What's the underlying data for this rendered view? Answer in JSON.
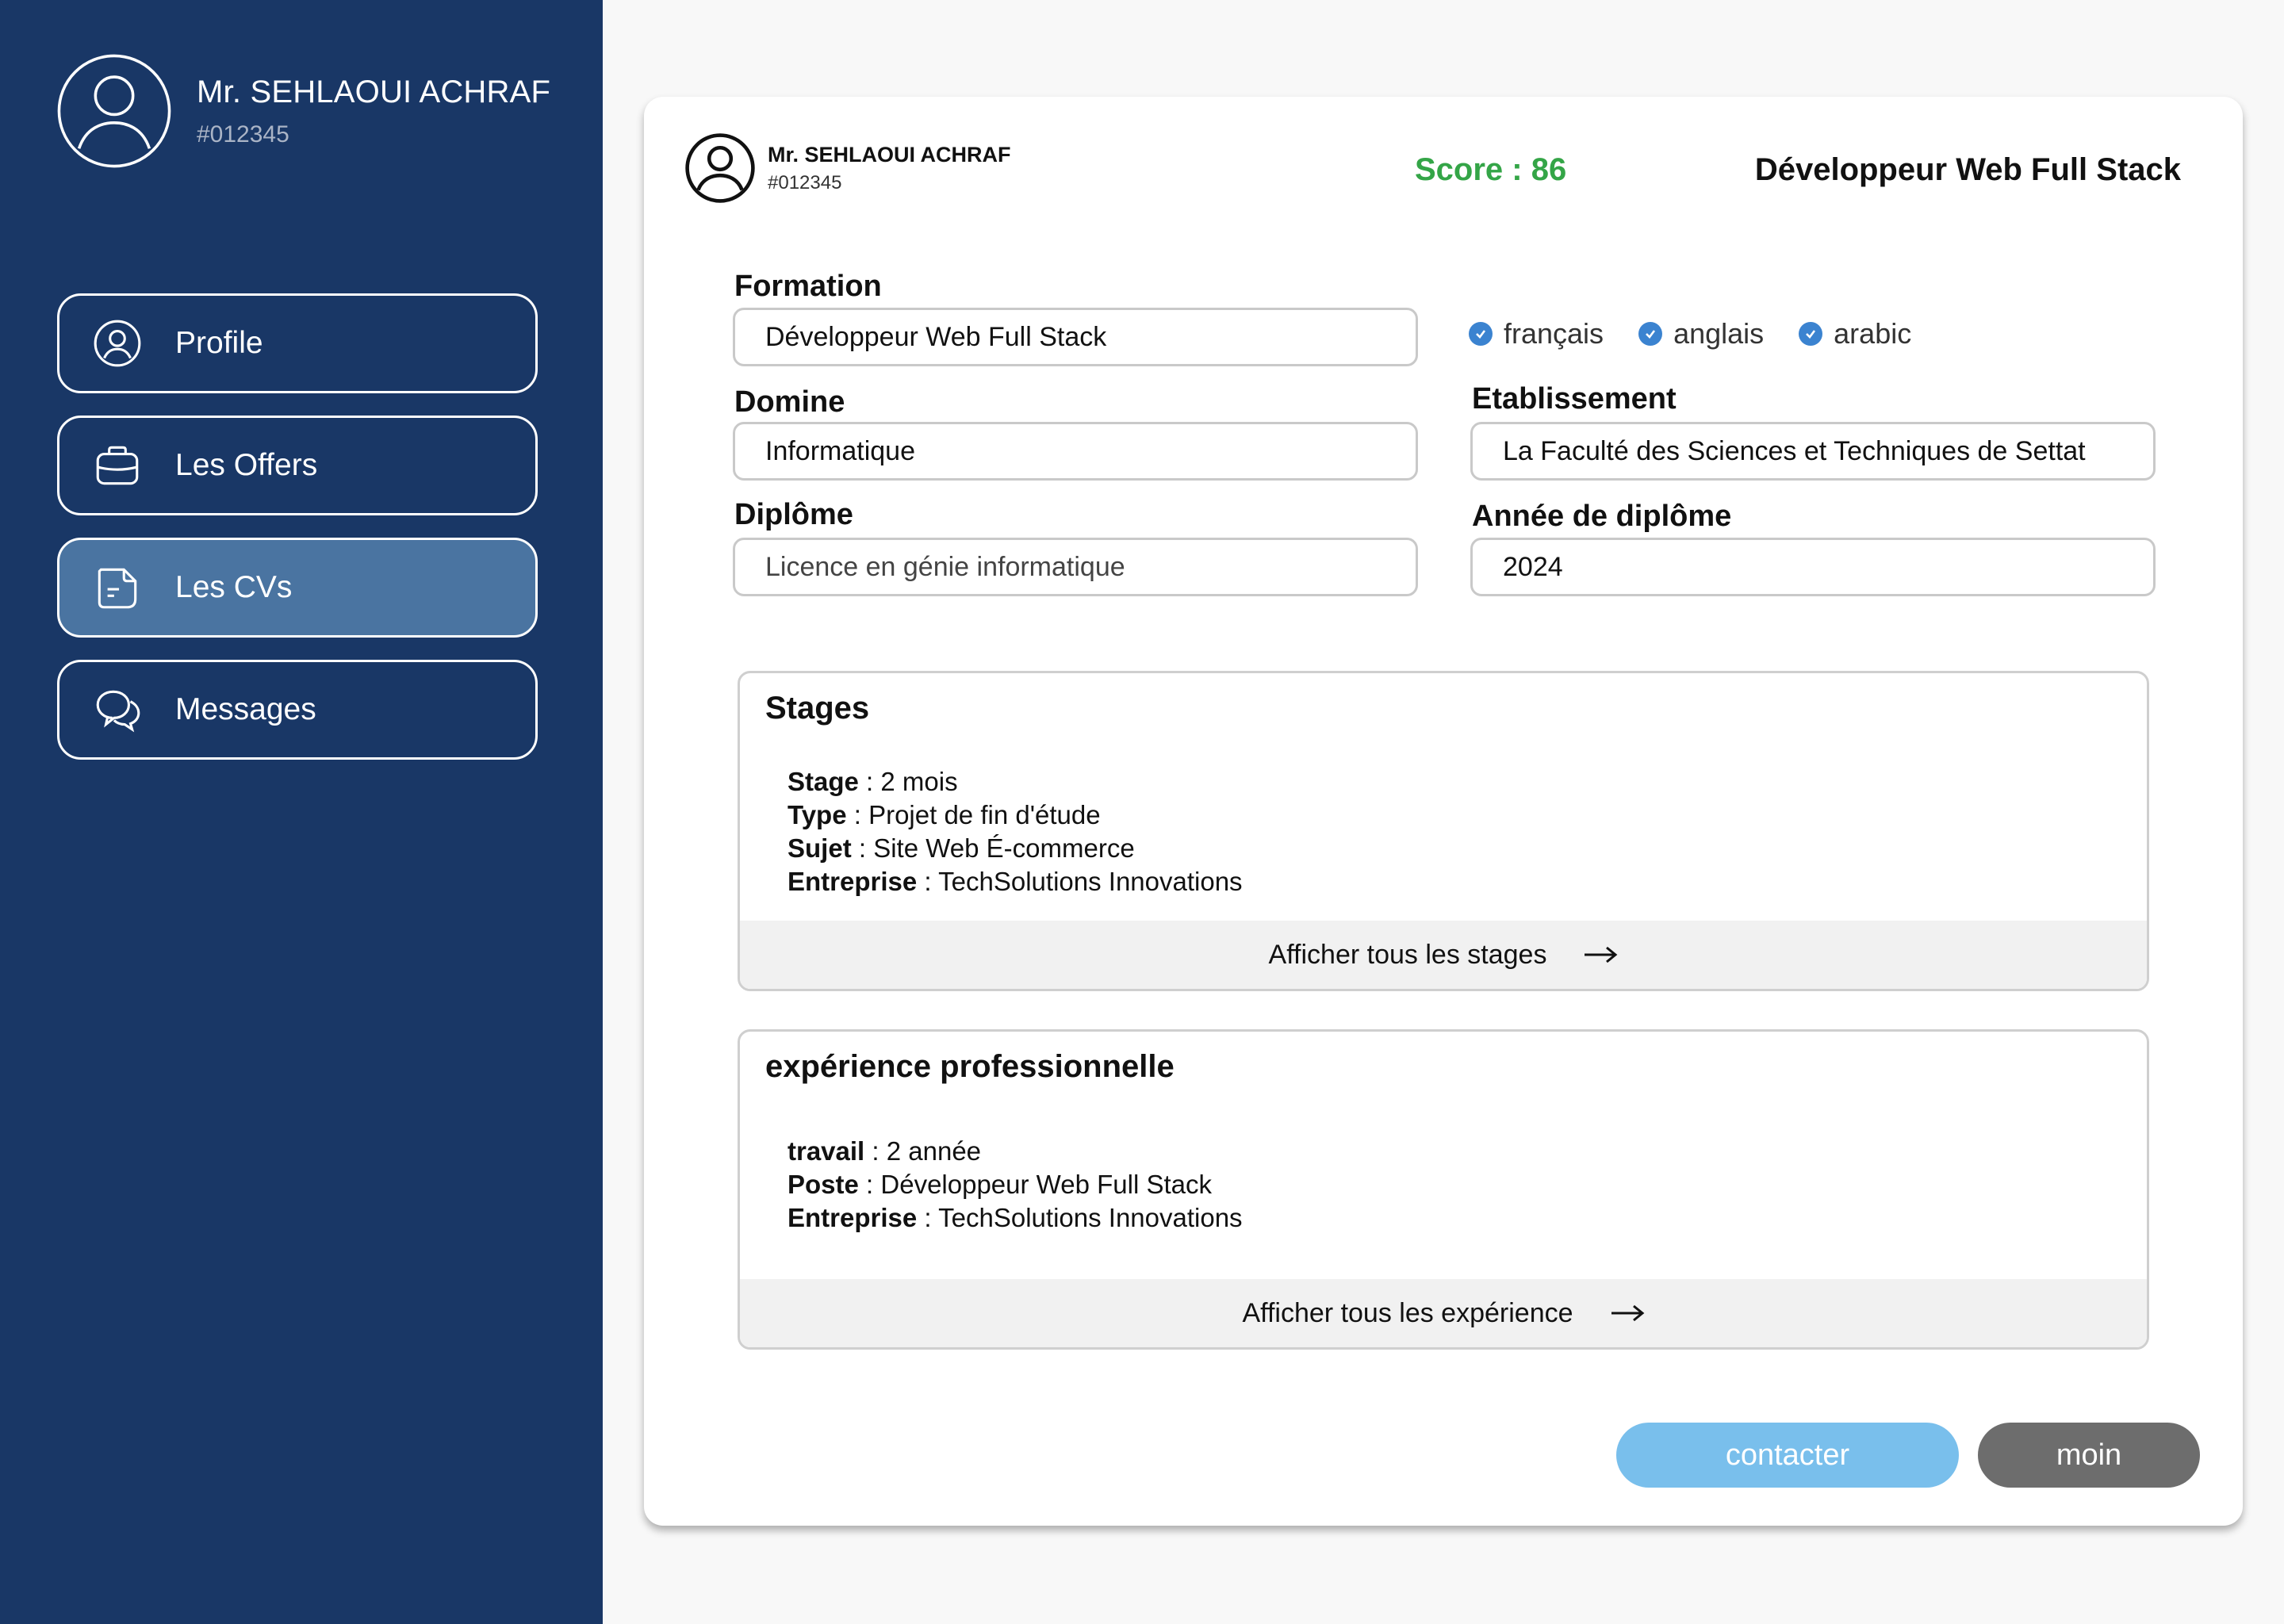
{
  "sidebar": {
    "user_name": "Mr. SEHLAOUI ACHRAF",
    "user_id": "#012345",
    "avatar_icon": "user-circle-icon",
    "items": [
      {
        "label": "Profile",
        "icon": "user-circle-icon",
        "active": false
      },
      {
        "label": "Les Offers",
        "icon": "briefcase-icon",
        "active": false
      },
      {
        "label": "Les CVs",
        "icon": "document-icon",
        "active": true
      },
      {
        "label": "Messages",
        "icon": "chat-bubbles-icon",
        "active": false
      }
    ]
  },
  "header": {
    "name": "Mr. SEHLAOUI ACHRAF",
    "id": "#012345",
    "score": "Score : 86",
    "job_title": "Développeur Web Full Stack"
  },
  "form": {
    "formation_label": "Formation",
    "formation_value": "Développeur Web Full Stack",
    "domaine_label": "Domine",
    "domaine_value": "Informatique",
    "diplome_label": "Diplôme",
    "diplome_value": "Licence en génie informatique",
    "etablissement_label": "Etablissement",
    "etablissement_value": "La Faculté des Sciences et Techniques de Settat",
    "annee_label": "Année de diplôme",
    "annee_value": "2024",
    "languages": [
      "français",
      "anglais",
      "arabic"
    ]
  },
  "stages": {
    "title": "Stages",
    "rows": [
      {
        "key": "Stage",
        "value": " : 2 mois"
      },
      {
        "key": "Type",
        "value": " : Projet de fin d'étude"
      },
      {
        "key": "Sujet",
        "value": " : Site Web É-commerce"
      },
      {
        "key": "Entreprise",
        "value": " : TechSolutions Innovations"
      }
    ],
    "footer": "Afficher tous les stages"
  },
  "experience": {
    "title": "expérience professionnelle",
    "rows": [
      {
        "key": "travail",
        "value": " : 2 année"
      },
      {
        "key": "Poste",
        "value": " : Développeur Web Full Stack"
      },
      {
        "key": "Entreprise",
        "value": " : TechSolutions Innovations"
      }
    ],
    "footer": "Afficher tous les expérience"
  },
  "actions": {
    "contact_label": "contacter",
    "moin_label": "moin"
  },
  "colors": {
    "sidebar_bg": "#193766",
    "active_nav": "#4a74a1",
    "score": "#34a547",
    "contact_button": "#79bfec",
    "moin_button": "#6d6d6d",
    "check": "#3b83d0"
  }
}
